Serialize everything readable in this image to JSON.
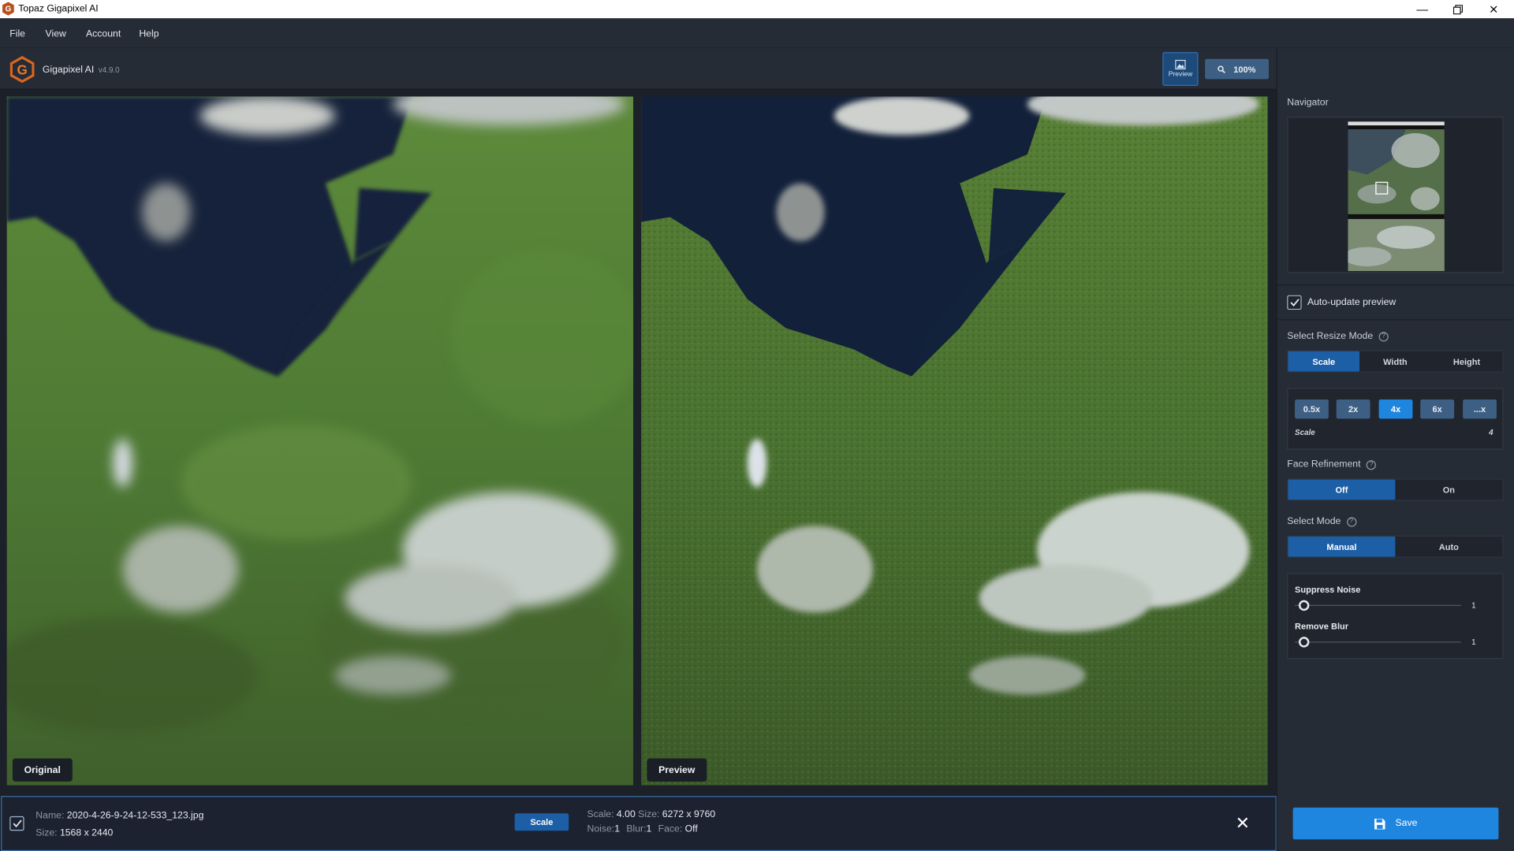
{
  "window": {
    "title": "Topaz Gigapixel AI"
  },
  "menu": [
    "File",
    "View",
    "Account",
    "Help"
  ],
  "header": {
    "app_name": "Gigapixel AI",
    "version": "v4.9.0",
    "preview_label": "Preview",
    "zoom": "100%"
  },
  "panes": {
    "original_label": "Original",
    "preview_label": "Preview"
  },
  "file": {
    "name_label": "Name:",
    "name": "2020-4-26-9-24-12-533_123.jpg",
    "size_label": "Size:",
    "size": "1568 x 2440",
    "mode_pill": "Scale",
    "scale_label": "Scale:",
    "scale": "4.00",
    "out_size_label": "Size:",
    "out_size": "6272 x 9760",
    "noise_label": "Noise:",
    "noise": "1",
    "blur_label": "Blur:",
    "blur": "1",
    "face_label": "Face:",
    "face": "Off"
  },
  "panel": {
    "navigator_title": "Navigator",
    "auto_update_label": "Auto-update preview",
    "auto_update_checked": true,
    "resize_mode": {
      "title": "Select Resize Mode",
      "options": [
        "Scale",
        "Width",
        "Height"
      ],
      "selected": "Scale"
    },
    "scale_options": [
      "0.5x",
      "2x",
      "4x",
      "6x",
      "...x"
    ],
    "scale_selected": "4x",
    "scale_label": "Scale",
    "scale_value": "4",
    "face_refinement": {
      "title": "Face Refinement",
      "options": [
        "Off",
        "On"
      ],
      "selected": "Off"
    },
    "select_mode": {
      "title": "Select Mode",
      "options": [
        "Manual",
        "Auto"
      ],
      "selected": "Manual"
    },
    "suppress_noise": {
      "label": "Suppress Noise",
      "value": "1"
    },
    "remove_blur": {
      "label": "Remove Blur",
      "value": "1"
    },
    "save_label": "Save"
  },
  "colors": {
    "accent": "#1f86e0",
    "selected": "#1d5fa7",
    "chip": "#3e5f84",
    "water": "#14213a",
    "land": "#4f7a34"
  }
}
